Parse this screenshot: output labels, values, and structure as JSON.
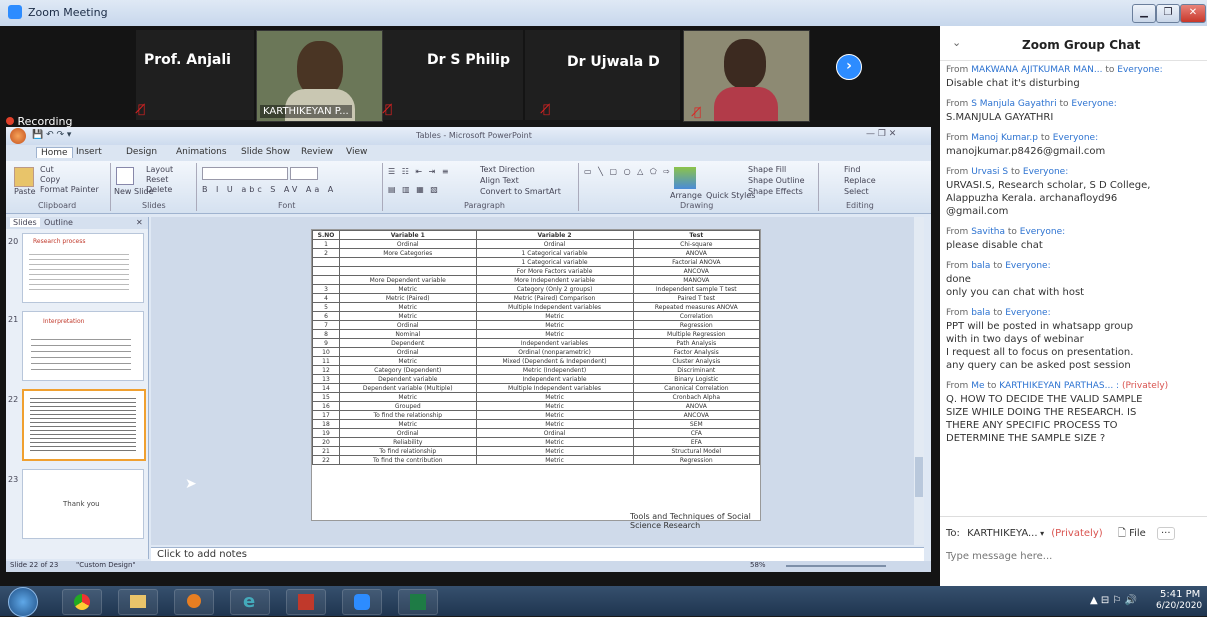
{
  "window": {
    "title": "Zoom Meeting",
    "controls": [
      "minimize",
      "maximize",
      "close"
    ]
  },
  "participants": [
    {
      "name": "Prof. Anjali",
      "video": false,
      "muted": true
    },
    {
      "name": "KARTHIKEYAN P...",
      "video": true,
      "muted": false
    },
    {
      "name": "Dr S Philip",
      "video": false,
      "muted": true
    },
    {
      "name": "Dr Ujwala D",
      "video": false,
      "muted": true
    },
    {
      "name": "",
      "video": true,
      "muted": true
    }
  ],
  "next_arrow_icon": "chevron-right-icon",
  "recording": {
    "label": "Recording",
    "color": "#e0402a"
  },
  "ppt": {
    "title": "Tables - Microsoft PowerPoint",
    "tabs": [
      "Home",
      "Insert",
      "Design",
      "Animations",
      "Slide Show",
      "Review",
      "View"
    ],
    "groups": [
      "Clipboard",
      "Slides",
      "Font",
      "Paragraph",
      "Drawing",
      "Editing"
    ],
    "clipboard": {
      "paste": "Paste",
      "cut": "Cut",
      "copy": "Copy",
      "format_painter": "Format Painter"
    },
    "slides_group": {
      "new_slide": "New Slide",
      "layout": "Layout",
      "reset": "Reset",
      "delete": "Delete"
    },
    "paragraph": {
      "text_direction": "Text Direction",
      "align_text": "Align Text",
      "convert": "Convert to SmartArt"
    },
    "drawing": {
      "arrange": "Arrange",
      "quick_styles": "Quick Styles",
      "shape_fill": "Shape Fill",
      "shape_outline": "Shape Outline",
      "shape_effects": "Shape Effects"
    },
    "editing": {
      "find": "Find",
      "replace": "Replace",
      "select": "Select"
    },
    "pane_tabs": [
      "Slides",
      "Outline"
    ],
    "thumb_titles": [
      "Research process",
      "Interpretation",
      "",
      "Thank you"
    ],
    "thumb_numbers": [
      "20",
      "21",
      "22",
      "23"
    ],
    "slide_footer": "Tools and Techniques of Social Science Research",
    "notes_placeholder": "Click to add notes",
    "status_left": "Slide 22 of 23",
    "status_theme": "\"Custom Design\"",
    "zoom": "58%"
  },
  "slide_table": {
    "headers": [
      "S.NO",
      "Variable 1",
      "Variable 2",
      "Test"
    ],
    "rows": [
      [
        "1",
        "Ordinal",
        "Ordinal",
        "Chi-square"
      ],
      [
        "2",
        "More Categories",
        "1 Categorical variable",
        "ANOVA"
      ],
      [
        "",
        "",
        "1 Categorical variable",
        "Factorial ANOVA"
      ],
      [
        "",
        "",
        "For More Factors variable",
        "ANCOVA"
      ],
      [
        "",
        "More Dependent variable",
        "More Independent variable",
        "MANOVA"
      ],
      [
        "3",
        "Metric",
        "Category (Only 2 groups)",
        "Independent sample T test"
      ],
      [
        "4",
        "Metric (Paired)",
        "Metric (Paired) Comparison",
        "Paired T test"
      ],
      [
        "5",
        "Metric",
        "Multiple Independent variables",
        "Repeated measures ANOVA"
      ],
      [
        "6",
        "Metric",
        "Metric",
        "Correlation"
      ],
      [
        "7",
        "Ordinal",
        "Metric",
        "Regression"
      ],
      [
        "8",
        "Nominal",
        "Metric",
        "Multiple Regression"
      ],
      [
        "9",
        "Dependent",
        "Independent variables",
        "Path Analysis"
      ],
      [
        "10",
        "Ordinal",
        "Ordinal (nonparametric)",
        "Factor Analysis"
      ],
      [
        "11",
        "Metric",
        "Mixed (Dependent & Independent)",
        "Cluster Analysis"
      ],
      [
        "12",
        "Category (Dependent)",
        "Metric (Independent)",
        "Discriminant"
      ],
      [
        "13",
        "Dependent variable",
        "Independent variable",
        "Binary Logistic"
      ],
      [
        "14",
        "Dependent variable (Multiple)",
        "Multiple Independent variables",
        "Canonical Correlation"
      ],
      [
        "15",
        "Metric",
        "Metric",
        "Cronbach Alpha"
      ],
      [
        "16",
        "Grouped",
        "Metric",
        "ANOVA"
      ],
      [
        "17",
        "To find the relationship",
        "Metric",
        "ANCOVA"
      ],
      [
        "18",
        "Metric",
        "Metric",
        "SEM"
      ],
      [
        "19",
        "Ordinal",
        "Ordinal",
        "CFA"
      ],
      [
        "20",
        "Reliability",
        "Metric",
        "EFA"
      ],
      [
        "21",
        "To find relationship",
        "Metric",
        "Structural Model"
      ],
      [
        "22",
        "To find the contribution",
        "Metric",
        "Regression"
      ]
    ]
  },
  "chat": {
    "title": "Zoom Group Chat",
    "messages": [
      {
        "from": "MAKWANA AJITKUMAR MAN...",
        "to": "Everyone",
        "private": false,
        "text": "Disable chat it's disturbing"
      },
      {
        "from": "S Manjula Gayathri",
        "to": "Everyone",
        "private": false,
        "text": "S.MANJULA GAYATHRI"
      },
      {
        "from": "Manoj Kumar.p",
        "to": "Everyone",
        "private": false,
        "text": "manojkumar.p8426@gmail.com"
      },
      {
        "from": "Urvasi S",
        "to": "Everyone",
        "private": false,
        "text": "URVASI.S,  Research scholar, S D College,\nAlappuzha Kerala.   archanafloyd96\n@gmail.com"
      },
      {
        "from": "Savitha",
        "to": "Everyone",
        "private": false,
        "text": "please disable chat"
      },
      {
        "from": "bala",
        "to": "Everyone",
        "private": false,
        "text": "done\nonly you can chat with host"
      },
      {
        "from": "bala",
        "to": "Everyone",
        "private": false,
        "text": "PPT will be posted in whatsapp group\nwith in two days of webinar\nI request all to focus on presentation.\nany query can be asked post session"
      },
      {
        "from": "Me",
        "to": "KARTHIKEYAN PARTHAS... ",
        "private": true,
        "text": "Q. HOW TO DECIDE THE VALID SAMPLE\nSIZE WHILE DOING THE  RESEARCH. IS\nTHERE ANY SPECIFIC PROCESS TO\nDETERMINE THE SAMPLE SIZE ?"
      }
    ],
    "to_label": "To:",
    "to_value": "KARTHIKEYA...",
    "privately": "(Privately)",
    "file_label": "File",
    "more_label": "···",
    "input_placeholder": "Type message here...",
    "from_word": "From",
    "to_word": "to",
    "private_tag": "(Privately)"
  },
  "taskbar": {
    "apps": [
      "start",
      "chrome",
      "file-explorer",
      "media-player",
      "internet-explorer",
      "acrobat",
      "zoom",
      "excel"
    ],
    "time": "5:41 PM",
    "date": "6/20/2020"
  }
}
